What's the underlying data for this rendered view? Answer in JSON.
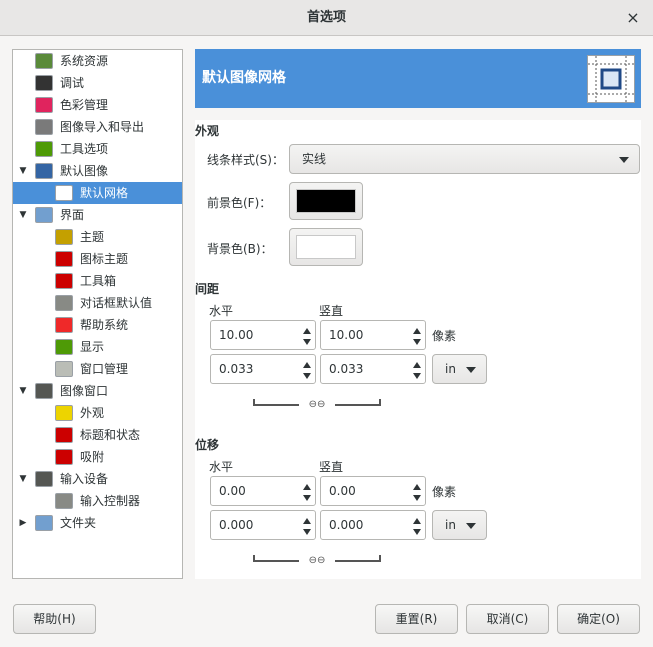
{
  "window": {
    "title": "首选项",
    "close_glyph": "×"
  },
  "tree": [
    {
      "label": "系统资源",
      "icon": "system-resources-icon",
      "depth": 1,
      "expander": "",
      "color": "#5a8a3a"
    },
    {
      "label": "调试",
      "icon": "debug-icon",
      "depth": 1,
      "expander": "",
      "color": "#333333"
    },
    {
      "label": "色彩管理",
      "icon": "color-management-icon",
      "depth": 1,
      "expander": "",
      "color": "#e0245e"
    },
    {
      "label": "图像导入和导出",
      "icon": "image-import-export-icon",
      "depth": 1,
      "expander": "",
      "color": "#7a7a7a"
    },
    {
      "label": "工具选项",
      "icon": "tool-options-icon",
      "depth": 1,
      "expander": "",
      "color": "#4e9a06"
    },
    {
      "label": "默认图像",
      "icon": "default-image-icon",
      "depth": 1,
      "expander": "▼",
      "color": "#3465a4"
    },
    {
      "label": "默认网格",
      "icon": "default-grid-icon",
      "depth": 2,
      "expander": "",
      "color": "#ffffff",
      "selected": true
    },
    {
      "label": "界面",
      "icon": "interface-icon",
      "depth": 1,
      "expander": "▼",
      "color": "#729fcf"
    },
    {
      "label": "主题",
      "icon": "theme-icon",
      "depth": 2,
      "expander": "",
      "color": "#c4a000"
    },
    {
      "label": "图标主题",
      "icon": "icon-theme-icon",
      "depth": 2,
      "expander": "",
      "color": "#cc0000"
    },
    {
      "label": "工具箱",
      "icon": "toolbox-icon",
      "depth": 2,
      "expander": "",
      "color": "#cc0000"
    },
    {
      "label": "对话框默认值",
      "icon": "dialog-defaults-icon",
      "depth": 2,
      "expander": "",
      "color": "#888a85"
    },
    {
      "label": "帮助系统",
      "icon": "help-system-icon",
      "depth": 2,
      "expander": "",
      "color": "#ef2929"
    },
    {
      "label": "显示",
      "icon": "display-icon",
      "depth": 2,
      "expander": "",
      "color": "#4e9a06"
    },
    {
      "label": "窗口管理",
      "icon": "window-management-icon",
      "depth": 2,
      "expander": "",
      "color": "#babdb6"
    },
    {
      "label": "图像窗口",
      "icon": "image-window-icon",
      "depth": 1,
      "expander": "▼",
      "color": "#555753"
    },
    {
      "label": "外观",
      "icon": "appearance-icon",
      "depth": 2,
      "expander": "",
      "color": "#edd400"
    },
    {
      "label": "标题和状态",
      "icon": "title-status-icon",
      "depth": 2,
      "expander": "",
      "color": "#cc0000"
    },
    {
      "label": "吸附",
      "icon": "snapping-icon",
      "depth": 2,
      "expander": "",
      "color": "#cc0000"
    },
    {
      "label": "输入设备",
      "icon": "input-devices-icon",
      "depth": 1,
      "expander": "▼",
      "color": "#555753"
    },
    {
      "label": "输入控制器",
      "icon": "input-controllers-icon",
      "depth": 2,
      "expander": "",
      "color": "#888a85"
    },
    {
      "label": "文件夹",
      "icon": "folders-icon",
      "depth": 1,
      "expander": "▶",
      "color": "#729fcf"
    }
  ],
  "header": {
    "title": "默认图像网格",
    "icon": "grid-icon"
  },
  "appearance": {
    "title": "外观",
    "line_style_label": "线条样式(S)：",
    "line_style_value": "实线",
    "fg_label": "前景色(F)：",
    "fg_color": "#000000",
    "bg_label": "背景色(B)：",
    "bg_color": "#ffffff"
  },
  "spacing": {
    "title": "间距",
    "h_label": "水平",
    "v_label": "竖直",
    "h_px": "10.00",
    "v_px": "10.00",
    "unit_px": "像素",
    "h_in": "0.033",
    "v_in": "0.033",
    "unit_in": "in"
  },
  "offset": {
    "title": "位移",
    "h_label": "水平",
    "v_label": "竖直",
    "h_px": "0.00",
    "v_px": "0.00",
    "unit_px": "像素",
    "h_in": "0.000",
    "v_in": "0.000",
    "unit_in": "in"
  },
  "buttons": {
    "help": "帮助(H)",
    "reset": "重置(R)",
    "cancel": "取消(C)",
    "ok": "确定(O)"
  }
}
